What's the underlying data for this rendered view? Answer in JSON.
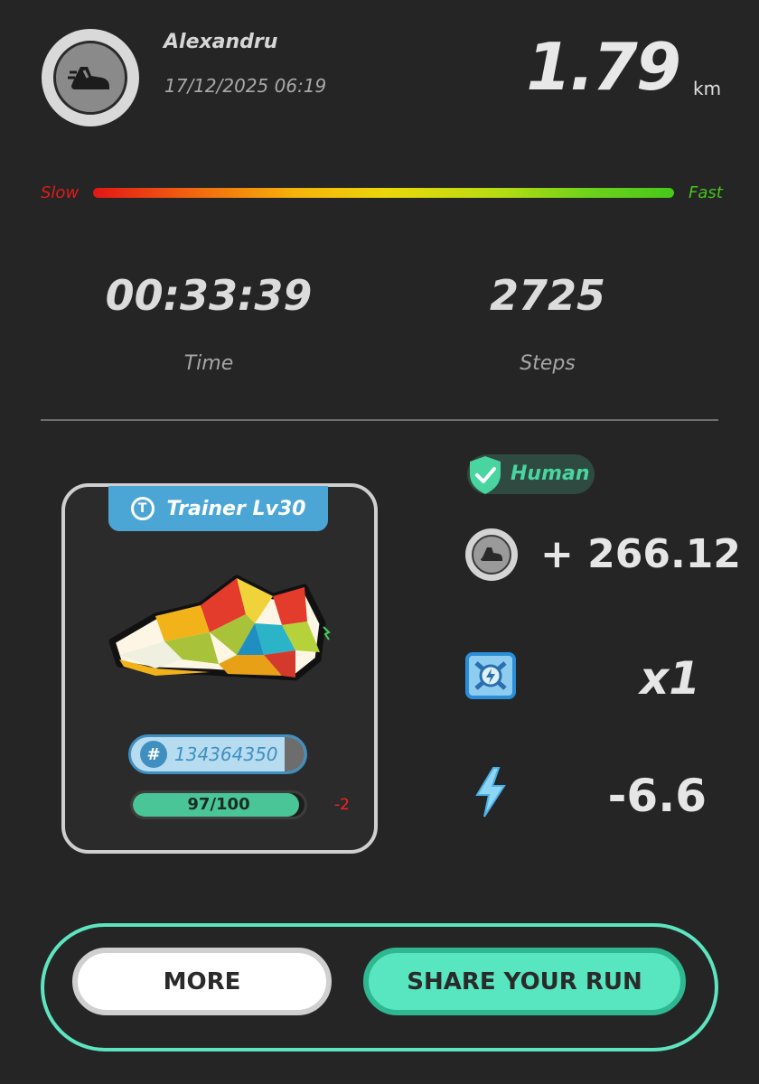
{
  "header": {
    "username": "Alexandru",
    "datetime": "17/12/2025 06:19",
    "distance": "1.79",
    "distance_unit": "km",
    "avatar_icon": "running-shoe-icon"
  },
  "speed_scale": {
    "slow_label": "Slow",
    "fast_label": "Fast",
    "colors": [
      "#e21616",
      "#f6b30a",
      "#ecd70a",
      "#46c81b"
    ]
  },
  "stats": {
    "time_value": "00:33:39",
    "time_label": "Time",
    "steps_value": "2725",
    "steps_label": "Steps"
  },
  "sneaker": {
    "badge_label": "Trainer Lv30",
    "badge_icon": "trainer-t-icon",
    "id_prefix": "#",
    "id_number": "134364350",
    "durability_text": "97/100",
    "durability_fraction": 0.97,
    "durability_delta": "-2"
  },
  "results": {
    "verification_label": "Human",
    "verification_icon": "shield-check-icon",
    "reward_icon": "shoe-coin-icon",
    "reward_value": "+ 266.12",
    "multiplier_icon": "booster-icon",
    "multiplier_value": "x1",
    "energy_icon": "lightning-bolt-icon",
    "energy_value": "-6.6"
  },
  "actions": {
    "more_label": "MORE",
    "share_label": "SHARE YOUR RUN"
  },
  "colors": {
    "background": "#252525",
    "accent_green": "#58e6c0",
    "accent_blue": "#4ba6d6",
    "slow_red": "#e01b1b",
    "fast_green": "#43c51a"
  }
}
